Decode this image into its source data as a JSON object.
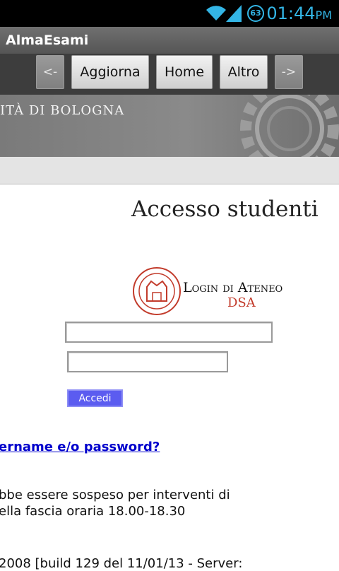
{
  "status_bar": {
    "time": "01:44",
    "ampm": "PM",
    "battery": "63",
    "icons": [
      "wifi-icon",
      "signal-icon",
      "battery-icon"
    ],
    "accent_color": "#33b5e5"
  },
  "app": {
    "title": "AlmaEsami"
  },
  "toolbar": {
    "back_label": "<-",
    "refresh_label": "Aggiorna",
    "home_label": "Home",
    "more_label": "Altro",
    "forward_label": "->"
  },
  "banner": {
    "text": "ITÀ DI BOLOGNA"
  },
  "content": {
    "heading": "Accesso studenti",
    "logo_main": "Login di Ateneo",
    "logo_sub": "DSA",
    "username_value": "",
    "password_value": "",
    "login_button_label": "Accedi",
    "login_button_color": "#5b5cf0",
    "forgot_link": "ername e/o password?",
    "notice_line1": "bbe essere sospeso per interventi di",
    "notice_line2": "ella fascia oraria 18.00-18.30",
    "footer_line": "2008 [build 129 del 11/01/13 - Server:"
  }
}
